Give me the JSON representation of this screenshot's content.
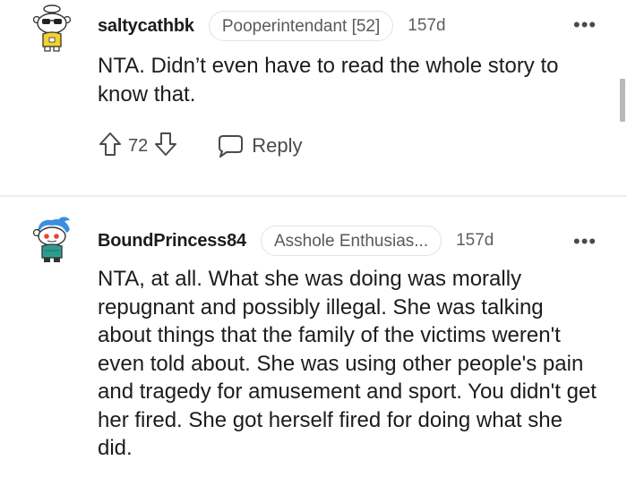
{
  "comments": [
    {
      "username": "saltycathbk",
      "flair": "Pooperintendant [52]",
      "age": "157d",
      "body": "NTA. Didn’t even have to read the whole story to know that.",
      "vote_count": "72",
      "reply_label": "Reply",
      "more_label": "•••"
    },
    {
      "username": "BoundPrincess84",
      "flair": "Asshole Enthusias...",
      "age": "157d",
      "body": "NTA, at all. What she was doing was morally repugnant and possibly illegal. She was talking about things that the family of the victims weren't even told about. She was using other people's pain and tragedy for amusement and sport. You didn't get her fired. She got herself fired for doing what she did.",
      "more_label": "•••"
    }
  ],
  "icons": {
    "upvote": "upvote-icon",
    "downvote": "downvote-icon",
    "reply": "reply-bubble-icon",
    "more": "more-options-icon"
  }
}
